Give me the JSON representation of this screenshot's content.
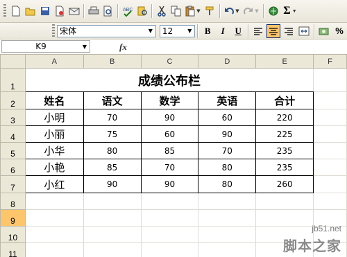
{
  "toolbar_standard": {
    "buttons": [
      {
        "name": "new-icon",
        "glyph": "🗋"
      },
      {
        "name": "open-icon",
        "glyph": "📂"
      },
      {
        "name": "save-icon",
        "glyph": "💾"
      },
      {
        "name": "permission-icon",
        "glyph": "🔒"
      },
      {
        "name": "mail-icon",
        "glyph": "✉"
      },
      {
        "name": "print-icon",
        "glyph": "🖶"
      },
      {
        "name": "print-preview-icon",
        "glyph": "🔍"
      },
      {
        "name": "spelling-icon",
        "glyph": "ABC"
      },
      {
        "name": "research-icon",
        "glyph": "📚"
      },
      {
        "name": "cut-icon",
        "glyph": "✂"
      },
      {
        "name": "copy-icon",
        "glyph": "⎘"
      },
      {
        "name": "paste-icon",
        "glyph": "📋"
      },
      {
        "name": "format-painter-icon",
        "glyph": "🖌"
      },
      {
        "name": "undo-icon",
        "glyph": "↶"
      },
      {
        "name": "redo-icon",
        "glyph": "↷"
      },
      {
        "name": "hyperlink-icon",
        "glyph": "🔗"
      },
      {
        "name": "autosum-icon",
        "glyph": "Σ"
      }
    ]
  },
  "toolbar_format": {
    "font": "宋体",
    "size": "12",
    "bold": "B",
    "italic": "I",
    "underline": "U"
  },
  "formula_bar": {
    "name_box": "K9",
    "fx": "fx",
    "formula": ""
  },
  "columns": [
    "A",
    "B",
    "C",
    "D",
    "E",
    "F"
  ],
  "rows": [
    "1",
    "2",
    "3",
    "4",
    "5",
    "6",
    "7",
    "8",
    "9",
    "10",
    "11"
  ],
  "selected_row": "9",
  "sheet": {
    "title": "成绩公布栏",
    "headers": [
      "姓名",
      "语文",
      "数学",
      "英语",
      "合计"
    ],
    "records": [
      [
        "小明",
        "70",
        "90",
        "60",
        "220"
      ],
      [
        "小丽",
        "75",
        "60",
        "90",
        "225"
      ],
      [
        "小华",
        "80",
        "85",
        "70",
        "235"
      ],
      [
        "小艳",
        "85",
        "70",
        "80",
        "235"
      ],
      [
        "小红",
        "90",
        "90",
        "80",
        "260"
      ]
    ]
  },
  "watermark": {
    "url": "jb51.net",
    "text": "脚本之家"
  }
}
